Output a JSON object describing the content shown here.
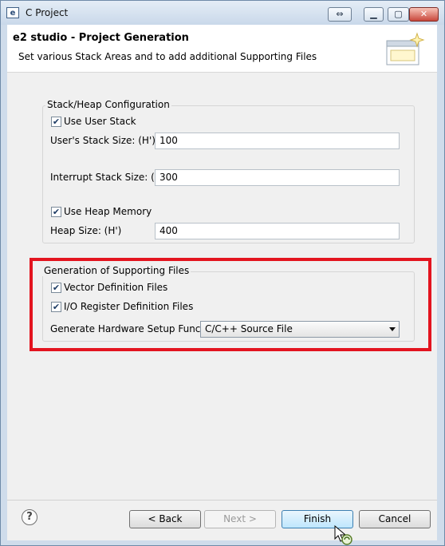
{
  "window": {
    "title": "C Project",
    "icon": "e2-studio-icon"
  },
  "header": {
    "title": "e2 studio - Project Generation",
    "description": "Set various Stack Areas and to add additional Supporting Files"
  },
  "stack_heap": {
    "group_label": "Stack/Heap Configuration",
    "use_user_stack": {
      "label": "Use User Stack",
      "checked": true
    },
    "user_stack_size": {
      "label": "User's Stack Size: (H')",
      "value": "100"
    },
    "interrupt_stack_size": {
      "label": "Interrupt Stack Size: (H')",
      "value": "300"
    },
    "use_heap_memory": {
      "label": "Use Heap Memory",
      "checked": true
    },
    "heap_size": {
      "label": "Heap Size: (H')",
      "value": "400"
    }
  },
  "supporting_files": {
    "group_label": "Generation of Supporting Files",
    "vector_definition": {
      "label": "Vector Definition Files",
      "checked": true
    },
    "io_register_definition": {
      "label": "I/O Register Definition Files",
      "checked": true
    },
    "hardware_setup": {
      "label": "Generate Hardware Setup Function",
      "selected": "C/C++ Source File"
    }
  },
  "buttons": {
    "help": "?",
    "back": "< Back",
    "next": "Next >",
    "finish": "Finish",
    "cancel": "Cancel"
  },
  "colors": {
    "highlight": "#e3141f",
    "finish_focus": "#3c7fb1"
  }
}
